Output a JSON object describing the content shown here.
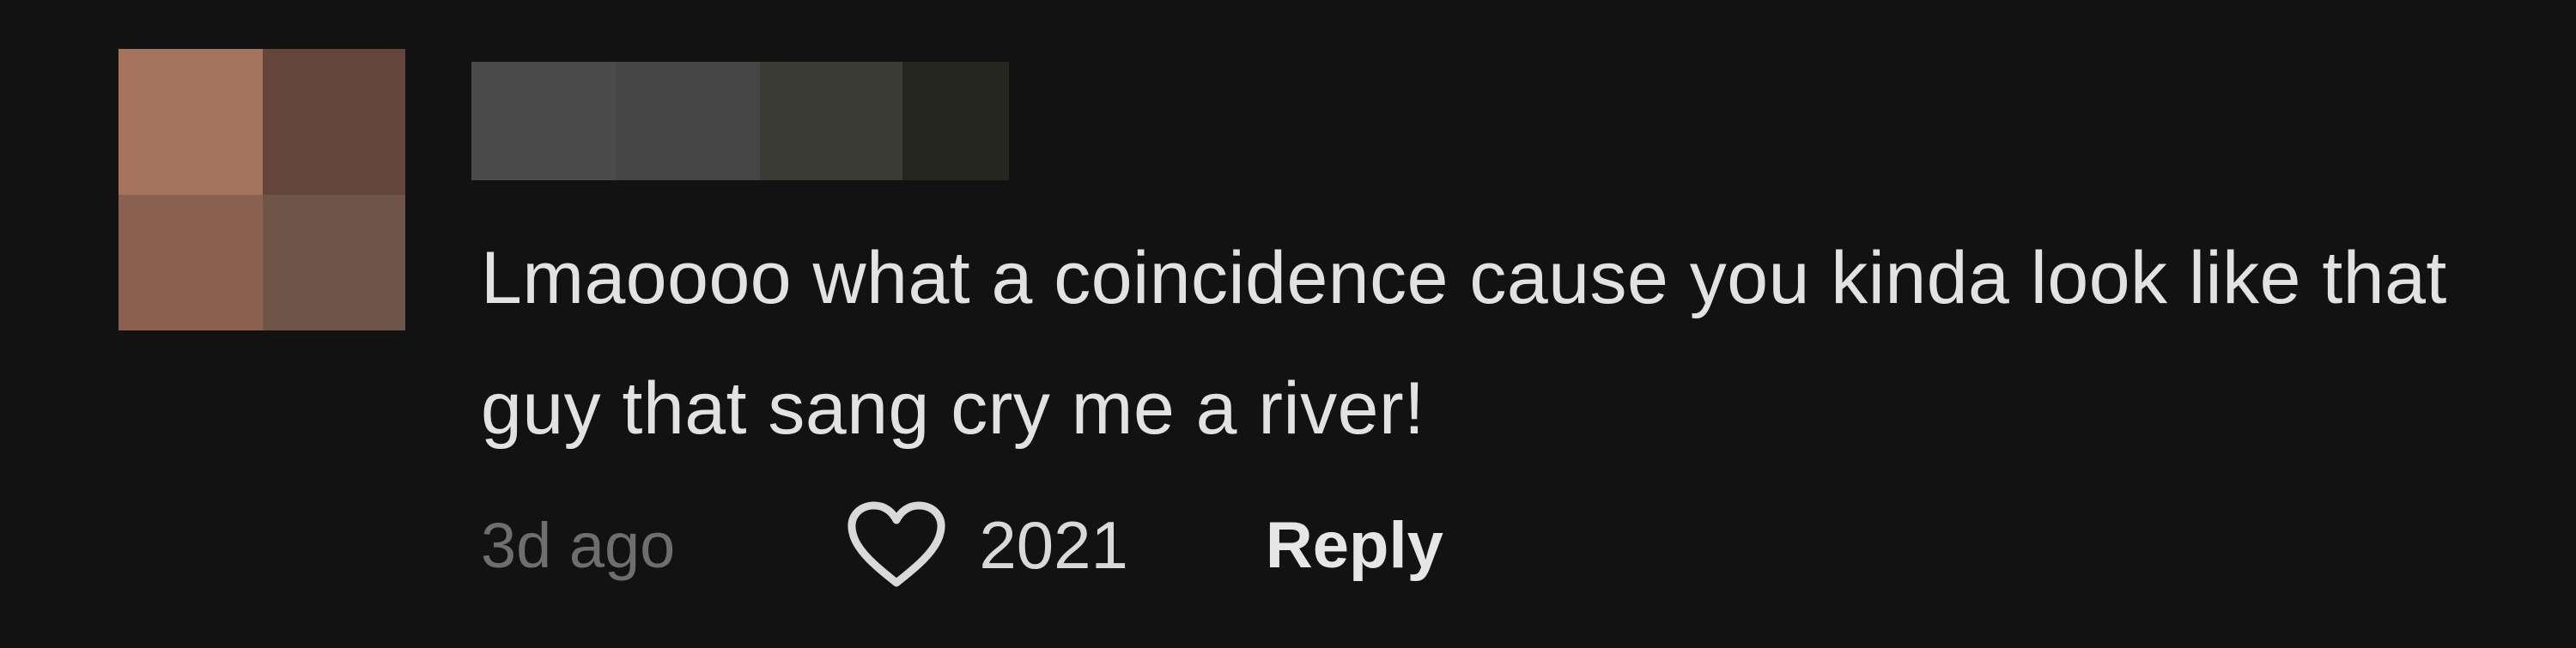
{
  "comment": {
    "text": "Lmaoooo what a coincidence cause you kinda look like that guy that sang cry me a river!",
    "timestamp": "3d ago",
    "like_count": "2021",
    "reply_label": "Reply",
    "avatar_censored": true,
    "username_censored": true
  },
  "icons": {
    "like": "heart-outline-icon"
  },
  "colors": {
    "background": "#121212",
    "text": "#e2e2e2",
    "muted": "#6e6e6e"
  }
}
